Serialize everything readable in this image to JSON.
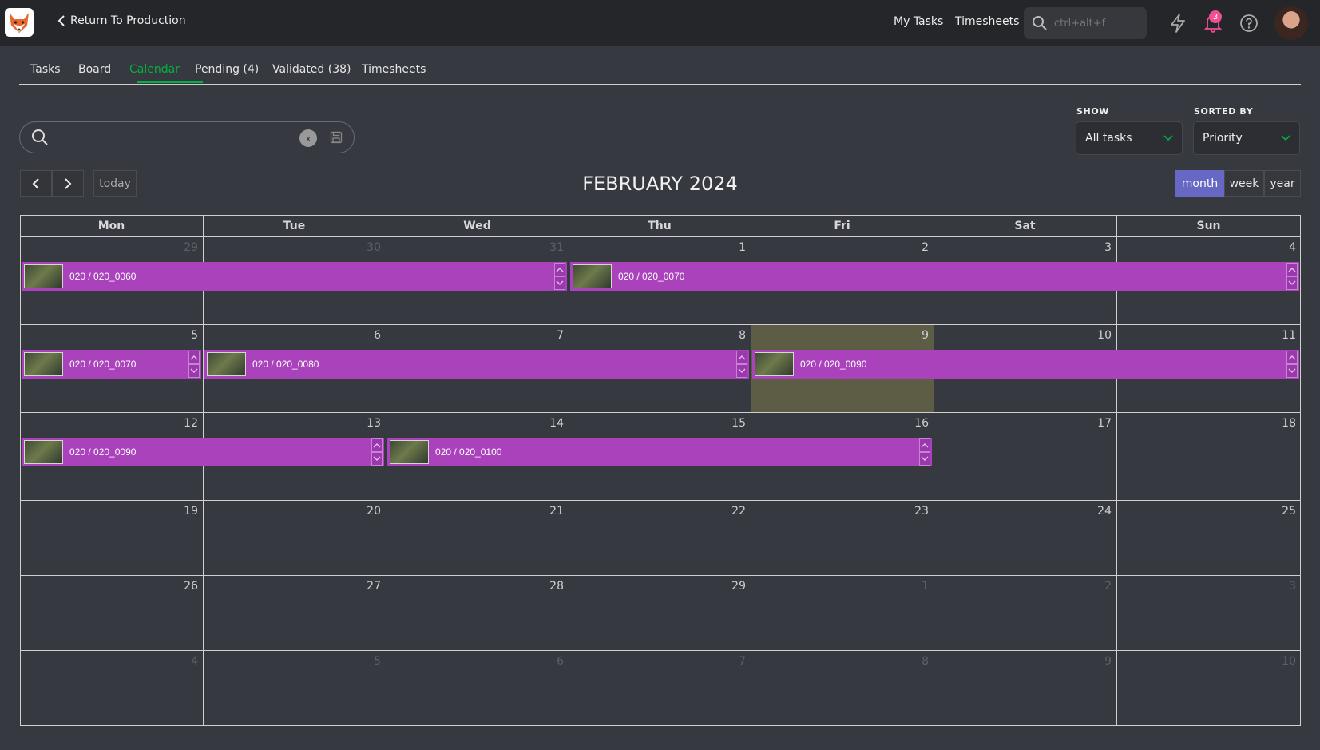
{
  "header": {
    "back_label": "Return To Production",
    "nav": [
      "My Tasks",
      "Timesheets"
    ],
    "search_placeholder": "ctrl+alt+f",
    "notification_count": "3"
  },
  "tabs": [
    {
      "label": "Tasks",
      "active": false
    },
    {
      "label": "Board",
      "active": false
    },
    {
      "label": "Calendar",
      "active": true
    },
    {
      "label": "Pending (4)",
      "active": false
    },
    {
      "label": "Validated (38)",
      "active": false
    },
    {
      "label": "Timesheets",
      "active": false
    }
  ],
  "filters": {
    "clear_label": "x",
    "show": {
      "label": "SHOW",
      "value": "All tasks"
    },
    "sorted_by": {
      "label": "SORTED BY",
      "value": "Priority"
    }
  },
  "calendar": {
    "title": "FEBRUARY 2024",
    "today_label": "today",
    "views": [
      {
        "label": "month",
        "active": true
      },
      {
        "label": "week",
        "active": false
      },
      {
        "label": "year",
        "active": false
      }
    ],
    "weekdays": [
      "Mon",
      "Tue",
      "Wed",
      "Thu",
      "Fri",
      "Sat",
      "Sun"
    ],
    "weeks": [
      [
        {
          "d": "29",
          "o": true
        },
        {
          "d": "30",
          "o": true
        },
        {
          "d": "31",
          "o": true
        },
        {
          "d": "1"
        },
        {
          "d": "2"
        },
        {
          "d": "3"
        },
        {
          "d": "4"
        }
      ],
      [
        {
          "d": "5"
        },
        {
          "d": "6"
        },
        {
          "d": "7"
        },
        {
          "d": "8"
        },
        {
          "d": "9",
          "today": true
        },
        {
          "d": "10"
        },
        {
          "d": "11"
        }
      ],
      [
        {
          "d": "12"
        },
        {
          "d": "13"
        },
        {
          "d": "14"
        },
        {
          "d": "15"
        },
        {
          "d": "16"
        },
        {
          "d": "17"
        },
        {
          "d": "18"
        }
      ],
      [
        {
          "d": "19"
        },
        {
          "d": "20"
        },
        {
          "d": "21"
        },
        {
          "d": "22"
        },
        {
          "d": "23"
        },
        {
          "d": "24"
        },
        {
          "d": "25"
        }
      ],
      [
        {
          "d": "26"
        },
        {
          "d": "27"
        },
        {
          "d": "28"
        },
        {
          "d": "29"
        },
        {
          "d": "1",
          "o": true
        },
        {
          "d": "2",
          "o": true
        },
        {
          "d": "3",
          "o": true
        }
      ],
      [
        {
          "d": "4",
          "o": true
        },
        {
          "d": "5",
          "o": true
        },
        {
          "d": "6",
          "o": true
        },
        {
          "d": "7",
          "o": true
        },
        {
          "d": "8",
          "o": true
        },
        {
          "d": "9",
          "o": true
        },
        {
          "d": "10",
          "o": true
        }
      ]
    ],
    "events": [
      {
        "label": "020 / 020_0060",
        "week": 0,
        "start": 0,
        "end": 2
      },
      {
        "label": "020 / 020_0070",
        "week": 0,
        "start": 3,
        "end": 6
      },
      {
        "label": "020 / 020_0070",
        "week": 1,
        "start": 0,
        "end": 0
      },
      {
        "label": "020 / 020_0080",
        "week": 1,
        "start": 1,
        "end": 3
      },
      {
        "label": "020 / 020_0090",
        "week": 1,
        "start": 4,
        "end": 6
      },
      {
        "label": "020 / 020_0090",
        "week": 2,
        "start": 0,
        "end": 1
      },
      {
        "label": "020 / 020_0100",
        "week": 2,
        "start": 2,
        "end": 4
      }
    ]
  },
  "colors": {
    "accent": "#00b242",
    "event": "#aa42bc",
    "view_active": "#6768c4",
    "today_bg": "#5d5c44"
  }
}
